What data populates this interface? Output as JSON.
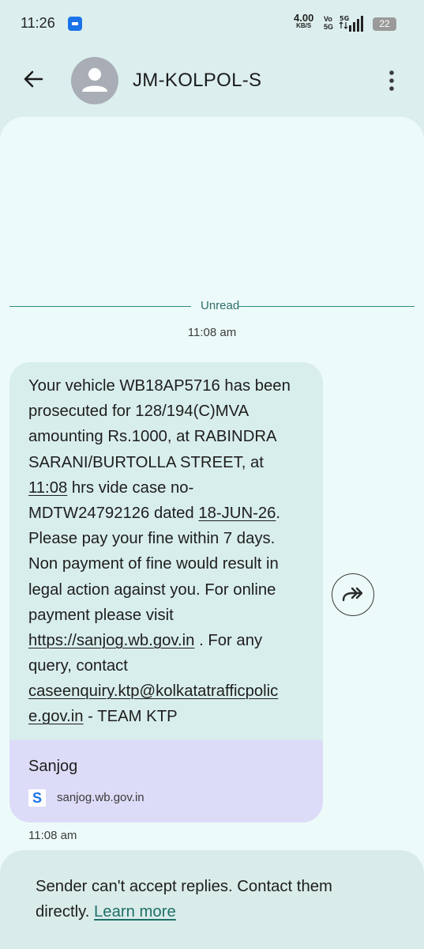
{
  "status_bar": {
    "time": "11:26",
    "speed_value": "4.00",
    "speed_unit": "KB/S",
    "volte_top": "Vo",
    "volte_bottom": "5G",
    "network": "5G",
    "battery": "22"
  },
  "header": {
    "contact_name": "JM-KOLPOL-S"
  },
  "conversation": {
    "unread_label": "Unread",
    "date_stamp": "11:08 am",
    "message": {
      "line1": "Your vehicle WB18AP5716 has been",
      "line2": "prosecuted for 128/194(C)MVA",
      "line3": "amounting Rs.1000, at RABINDRA",
      "line4": "SARANI/BURTOLLA STREET, at",
      "time_link": "11:08",
      "line5_rest": " hrs vide case no-",
      "line6_pre": "MDTW24792126 dated ",
      "date_link": "18-JUN-26",
      "line6_post": ".",
      "line7": "Please pay your fine within 7 days.",
      "line8": "Non payment of fine would result in",
      "line9": "legal action against you. For online",
      "line10": "payment please visit",
      "url_link": "https://sanjog.wb.gov.in",
      "line11_rest": " . For any",
      "line12": "query, contact",
      "email_part1": "caseenquiry.ktp@kolkatatrafficpolic",
      "email_part2": "e.gov.in",
      "line14_rest": " - TEAM KTP"
    },
    "link_preview": {
      "title": "Sanjog",
      "favicon_letter": "S",
      "domain": "sanjog.wb.gov.in"
    },
    "message_time": "11:08 am"
  },
  "footer": {
    "notice_line1": "Sender can't accept replies. Contact them",
    "notice_line2_pre": "directly. ",
    "learn_more": "Learn more"
  }
}
